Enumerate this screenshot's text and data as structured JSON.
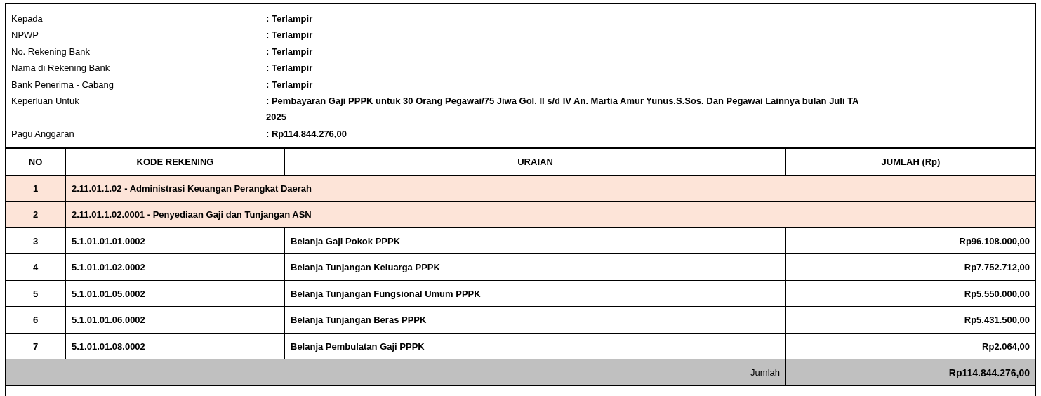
{
  "info": [
    {
      "label": "Kepada",
      "value": ": Terlampir"
    },
    {
      "label": "NPWP",
      "value": ": Terlampir"
    },
    {
      "label": "No. Rekening Bank",
      "value": ": Terlampir"
    },
    {
      "label": "Nama di Rekening Bank",
      "value": ": Terlampir"
    },
    {
      "label": "Bank Penerima - Cabang",
      "value": ": Terlampir"
    },
    {
      "label": "Keperluan Untuk",
      "value": ": Pembayaran Gaji PPPK untuk 30 Orang Pegawai/75 Jiwa Gol. II s/d IV An. Martia Amur Yunus.S.Sos. Dan Pegawai Lainnya bulan Juli TA 2025"
    },
    {
      "label": "Pagu Anggaran",
      "value": ": Rp114.844.276,00"
    }
  ],
  "table": {
    "columns": [
      "NO",
      "KODE REKENING",
      "URAIAN",
      "JUMLAH (Rp)"
    ],
    "rows": [
      {
        "kind": "group",
        "no": "1",
        "text": "2.11.01.1.02 - Administrasi Keuangan Perangkat Daerah"
      },
      {
        "kind": "group",
        "no": "2",
        "text": "2.11.01.1.02.0001 - Penyediaan Gaji dan Tunjangan ASN"
      },
      {
        "kind": "item",
        "no": "3",
        "code": "5.1.01.01.01.0002",
        "desc": "Belanja Gaji Pokok PPPK",
        "amount": "Rp96.108.000,00"
      },
      {
        "kind": "item",
        "no": "4",
        "code": "5.1.01.01.02.0002",
        "desc": "Belanja Tunjangan Keluarga PPPK",
        "amount": "Rp7.752.712,00"
      },
      {
        "kind": "item",
        "no": "5",
        "code": "5.1.01.01.05.0002",
        "desc": "Belanja Tunjangan Fungsional Umum PPPK",
        "amount": "Rp5.550.000,00"
      },
      {
        "kind": "item",
        "no": "6",
        "code": "5.1.01.01.06.0002",
        "desc": "Belanja Tunjangan Beras PPPK",
        "amount": "Rp5.431.500,00"
      },
      {
        "kind": "item",
        "no": "7",
        "code": "5.1.01.01.08.0002",
        "desc": "Belanja Pembulatan Gaji PPPK",
        "amount": "Rp2.064,00"
      }
    ],
    "total": {
      "label": "Jumlah",
      "amount": "Rp114.844.276,00"
    }
  }
}
